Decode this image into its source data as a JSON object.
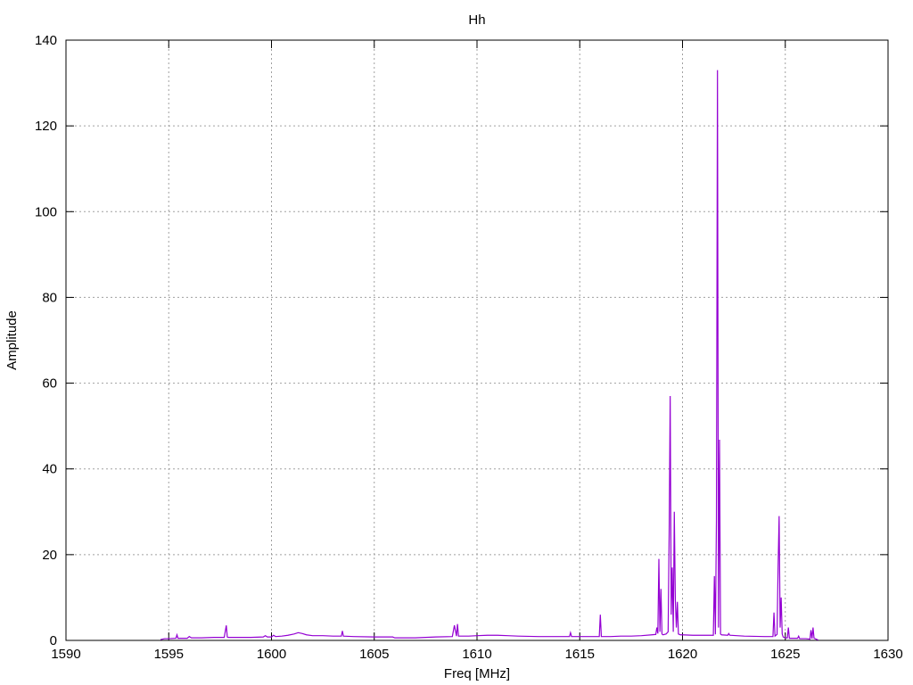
{
  "chart_data": {
    "type": "line",
    "title": "Hh",
    "xlabel": "Freq [MHz]",
    "ylabel": "Amplitude",
    "xlim": [
      1590,
      1630
    ],
    "ylim": [
      0,
      140
    ],
    "xticks": [
      1590,
      1595,
      1600,
      1605,
      1610,
      1615,
      1620,
      1625,
      1630
    ],
    "yticks": [
      0,
      20,
      40,
      60,
      80,
      100,
      120,
      140
    ],
    "grid": true,
    "line_color": "#9400d3",
    "series": [
      {
        "x": [
          1594.6,
          1594.8,
          1595.0,
          1595.35,
          1595.4,
          1595.45,
          1595.9,
          1596.0,
          1596.1,
          1596.6,
          1597.2,
          1597.7,
          1597.8,
          1597.85,
          1597.9,
          1598.5,
          1599.0,
          1599.6,
          1599.7,
          1599.8,
          1600.0,
          1600.1,
          1600.2,
          1600.5,
          1600.8,
          1601.1,
          1601.3,
          1601.5,
          1601.7,
          1602.0,
          1602.5,
          1603.0,
          1603.4,
          1603.45,
          1603.5,
          1604.0,
          1605.0,
          1605.9,
          1606.0,
          1607.0,
          1607.5,
          1608.0,
          1608.8,
          1608.9,
          1609.0,
          1609.05,
          1609.1,
          1609.6,
          1610.0,
          1610.5,
          1611.0,
          1611.5,
          1612.0,
          1613.0,
          1614.0,
          1614.5,
          1614.55,
          1614.6,
          1615.5,
          1615.95,
          1616.0,
          1616.05,
          1616.5,
          1617.0,
          1617.5,
          1618.0,
          1618.5,
          1618.7,
          1618.75,
          1618.8,
          1618.85,
          1618.9,
          1618.95,
          1619.0,
          1619.05,
          1619.2,
          1619.3,
          1619.35,
          1619.4,
          1619.45,
          1619.5,
          1619.55,
          1619.6,
          1619.65,
          1619.7,
          1619.75,
          1619.8,
          1619.9,
          1620.0,
          1620.5,
          1621.0,
          1621.5,
          1621.55,
          1621.6,
          1621.65,
          1621.7,
          1621.75,
          1621.8,
          1621.85,
          1621.9,
          1622.2,
          1622.25,
          1622.3,
          1623.0,
          1624.0,
          1624.4,
          1624.45,
          1624.5,
          1624.6,
          1624.65,
          1624.7,
          1624.75,
          1624.8,
          1624.85,
          1624.9,
          1625.0,
          1625.1,
          1625.15,
          1625.2,
          1625.5,
          1625.6,
          1625.65,
          1625.7,
          1626.0,
          1626.2,
          1626.25,
          1626.3,
          1626.35,
          1626.4,
          1626.5,
          1626.6
        ],
        "y": [
          0.2,
          0.4,
          0.4,
          0.5,
          1.3,
          0.5,
          0.5,
          0.9,
          0.6,
          0.6,
          0.7,
          0.7,
          3.5,
          0.8,
          0.7,
          0.7,
          0.7,
          0.8,
          1.1,
          0.8,
          0.8,
          1.2,
          0.9,
          1.0,
          1.2,
          1.5,
          1.8,
          1.6,
          1.3,
          1.1,
          1.1,
          1.0,
          1.0,
          2.2,
          1.0,
          0.9,
          0.8,
          0.8,
          0.6,
          0.6,
          0.7,
          0.8,
          0.9,
          3.5,
          1.0,
          3.8,
          1.0,
          1.0,
          1.1,
          1.2,
          1.2,
          1.1,
          1.0,
          0.9,
          0.9,
          0.9,
          1.8,
          0.9,
          0.9,
          0.9,
          6.0,
          0.9,
          0.9,
          1.0,
          1.0,
          1.1,
          1.3,
          1.4,
          3.0,
          1.6,
          19.0,
          2.0,
          12.0,
          1.5,
          1.3,
          1.5,
          2.0,
          25.0,
          57.0,
          6.0,
          17.0,
          2.0,
          30.0,
          9.5,
          3.0,
          9.0,
          1.5,
          1.3,
          1.3,
          1.2,
          1.2,
          1.2,
          15.0,
          1.4,
          28.0,
          133.0,
          3.0,
          46.8,
          1.5,
          1.3,
          1.2,
          1.6,
          1.2,
          1.0,
          0.9,
          0.9,
          6.5,
          1.0,
          1.4,
          17.0,
          29.0,
          3.0,
          10.0,
          1.5,
          0.8,
          0.6,
          0.6,
          3.0,
          0.5,
          0.5,
          0.5,
          1.0,
          0.4,
          0.4,
          0.3,
          2.4,
          0.4,
          3.0,
          0.5,
          0.3,
          0.1
        ]
      }
    ]
  }
}
